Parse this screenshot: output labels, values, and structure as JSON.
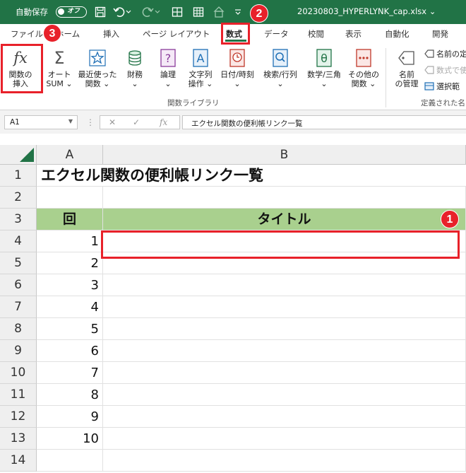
{
  "titlebar": {
    "autosave_label": "自動保存",
    "autosave_state": "オフ",
    "filename": "20230803_HYPERLYNK_cap.xlsx",
    "filename_chevron": "⌄"
  },
  "tabs": [
    "ファイル",
    "ホーム",
    "挿入",
    "ページ レイアウト",
    "数式",
    "データ",
    "校閲",
    "表示",
    "自動化",
    "開発"
  ],
  "active_tab": "数式",
  "ribbon": {
    "insert_function": {
      "line1": "関数の",
      "line2": "挿入"
    },
    "autosum": {
      "line1": "オート",
      "line2": "SUM ⌄"
    },
    "recent": {
      "line1": "最近使った",
      "line2": "関数 ⌄"
    },
    "financial": {
      "line1": "財務",
      "line2": "⌄"
    },
    "logical": {
      "line1": "論理",
      "line2": "⌄"
    },
    "text": {
      "line1": "文字列",
      "line2": "操作 ⌄"
    },
    "datetime": {
      "line1": "日付/時刻",
      "line2": "⌄"
    },
    "lookup": {
      "line1": "検索/行列",
      "line2": "⌄"
    },
    "math": {
      "line1": "数学/三角",
      "line2": "⌄"
    },
    "more": {
      "line1": "その他の",
      "line2": "関数 ⌄"
    },
    "library_label": "関数ライブラリ",
    "name_manager": {
      "line1": "名前",
      "line2": "の管理"
    },
    "define_name": "名前の定",
    "use_in_formula": "数式で使",
    "create_from_selection": "選択範",
    "defined_names_label": "定義された名"
  },
  "formula_bar": {
    "name_box": "A1",
    "fx": "fx",
    "content": "エクセル関数の便利帳リンク一覧"
  },
  "sheet": {
    "columns": [
      "A",
      "B"
    ],
    "title": "エクセル関数の便利帳リンク一覧",
    "header_a": "回",
    "header_b": "タイトル",
    "row_numbers": [
      "1",
      "2",
      "3",
      "4",
      "5",
      "6",
      "7",
      "8",
      "9",
      "10",
      "11",
      "12",
      "13",
      "14"
    ],
    "values": [
      "1",
      "2",
      "3",
      "4",
      "5",
      "6",
      "7",
      "8",
      "9",
      "10"
    ]
  },
  "callouts": [
    "1",
    "2",
    "3"
  ],
  "colors": {
    "excel_green": "#217346",
    "header_fill": "#a9d08e",
    "callout_red": "#e8212a"
  }
}
